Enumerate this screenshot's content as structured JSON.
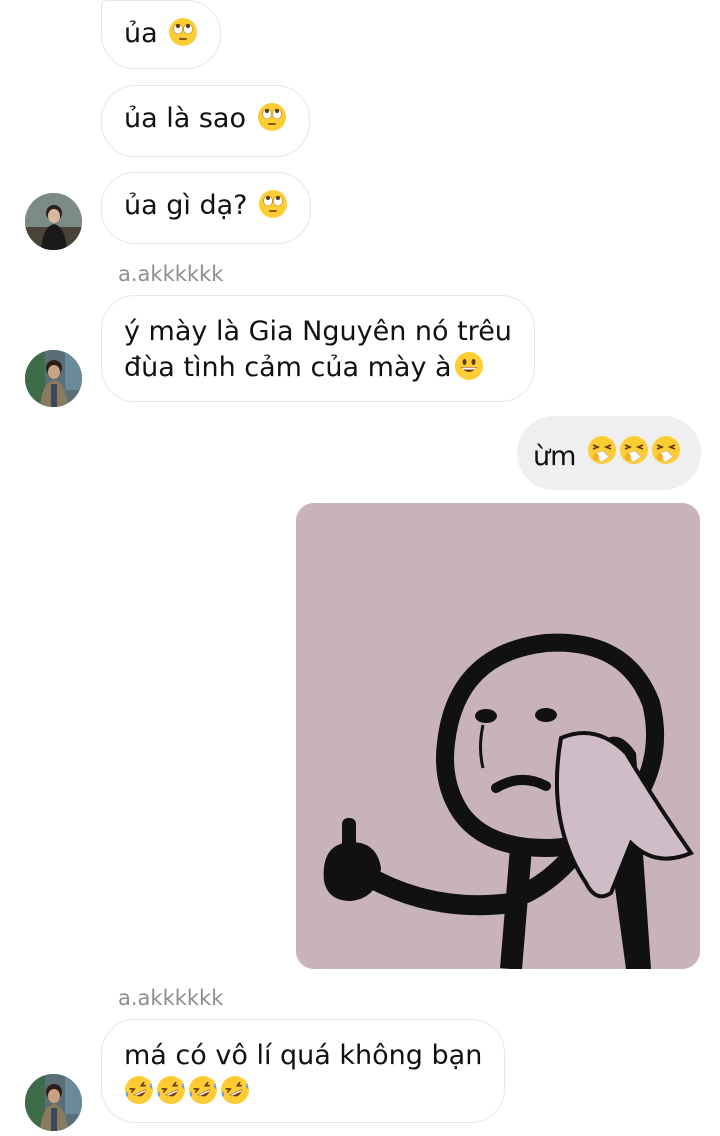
{
  "messages": [
    {
      "side": "in",
      "text": "ủa",
      "emoji": "eye-roll-emoji"
    },
    {
      "side": "in",
      "text": "ủa là sao",
      "emoji": "eye-roll-emoji"
    },
    {
      "side": "in",
      "text": "ủa gì dạ?",
      "emoji": "eye-roll-emoji"
    },
    {
      "side": "in",
      "sender": "a.akkkkkk",
      "line1": "ý mày là Gia Nguyên nó trêu",
      "line2": "đùa tình cảm của mày à",
      "emoji": "grinning-emoji"
    },
    {
      "side": "out",
      "text": "ừm",
      "emoji": "sneezing-emoji"
    },
    {
      "side": "out",
      "type": "image",
      "content": "crying-stickman-meme"
    },
    {
      "side": "in",
      "sender": "a.akkkkkk",
      "line1": "má có vô lí quá không bạn",
      "emoji": "rolling-laughing-emoji"
    }
  ],
  "colors": {
    "incoming_border": "#e6e6e6",
    "outgoing_bg": "#efefef",
    "sender_text": "#8e8e8e",
    "meme_bg": "#c8b3bd"
  }
}
